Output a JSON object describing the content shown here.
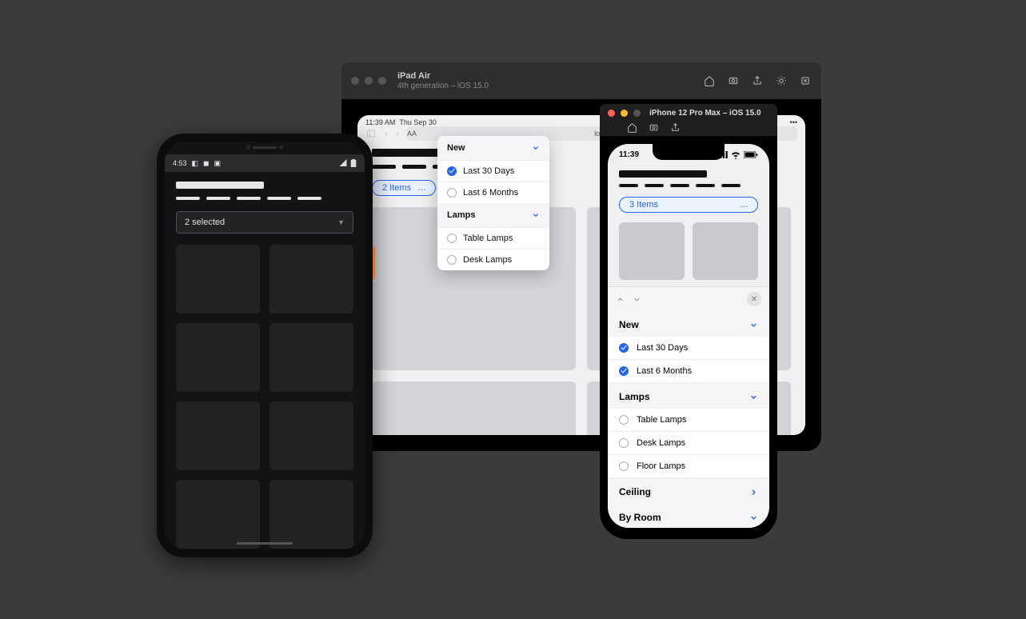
{
  "ipad": {
    "window_title": "iPad Air",
    "window_subtitle": "4th generation – iOS 15.0",
    "status_time": "11:39 AM",
    "status_date": "Thu Sep 30",
    "url_aa": "AA",
    "url_host": "localhost",
    "filter_pill": "2 Items",
    "popup": {
      "sections": [
        {
          "title": "New",
          "options": [
            {
              "label": "Last 30 Days",
              "checked": true
            },
            {
              "label": "Last 6 Months",
              "checked": false
            }
          ]
        },
        {
          "title": "Lamps",
          "options": [
            {
              "label": "Table Lamps",
              "checked": false
            },
            {
              "label": "Desk Lamps",
              "checked": false
            }
          ]
        }
      ]
    }
  },
  "iphone": {
    "window_title": "iPhone 12 Pro Max – iOS 15.0",
    "status_time": "11:39",
    "filter_pill": "3 Items",
    "sheet": {
      "sections": [
        {
          "title": "New",
          "expanded": true,
          "options": [
            {
              "label": "Last 30 Days",
              "checked": true
            },
            {
              "label": "Last 6 Months",
              "checked": true
            }
          ]
        },
        {
          "title": "Lamps",
          "expanded": true,
          "options": [
            {
              "label": "Table Lamps",
              "checked": false
            },
            {
              "label": "Desk Lamps",
              "checked": false
            },
            {
              "label": "Floor Lamps",
              "checked": false
            }
          ]
        },
        {
          "title": "Ceiling",
          "expanded": false,
          "options": []
        },
        {
          "title": "By Room",
          "expanded": false,
          "options": []
        }
      ]
    }
  },
  "android": {
    "status_time": "4:53",
    "select_label": "2 selected"
  }
}
